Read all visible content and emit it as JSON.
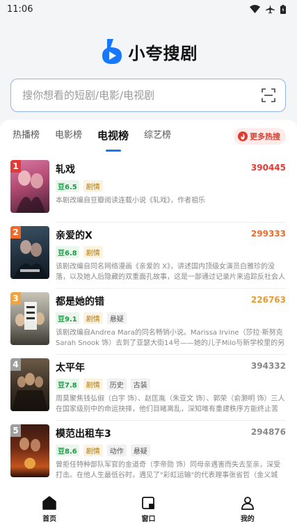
{
  "status_bar": {
    "time": "11:06"
  },
  "app": {
    "name": "小夸搜剧"
  },
  "search": {
    "placeholder": "搜你想看的短剧/电影/电视剧"
  },
  "tabs": [
    {
      "label": "热播榜"
    },
    {
      "label": "电影榜"
    },
    {
      "label": "电视榜"
    },
    {
      "label": "综艺榜"
    }
  ],
  "more_hot": {
    "label": "更多热搜"
  },
  "items": [
    {
      "rank": "1",
      "rank_color": "#e53935",
      "title": "轧戏",
      "heat": "390445",
      "heat_color": "#e53935",
      "score": "豆6.5",
      "genres": [
        "剧情"
      ],
      "desc": "本剧改编自豆瓣阅读连载小说《轧戏》，作者祖乐"
    },
    {
      "rank": "2",
      "rank_color": "#f06a28",
      "title": "亲爱的X",
      "heat": "299333",
      "heat_color": "#f06a28",
      "score": "豆6.8",
      "genres": [
        "剧情"
      ],
      "desc": "该剧改编自同名网络漫画《亲爱的 X》，讲述国内顶级女演员白雅珍的没落，以及她人后隐藏的双重面孔故事，这是一部通过记录片来追踪反社会人格女演员…"
    },
    {
      "rank": "3",
      "rank_color": "#f2a33a",
      "title": "都是她的错",
      "heat": "226763",
      "heat_color": "#e89a2c",
      "score": "豆9.1",
      "genres": [
        "剧情",
        "悬疑"
      ],
      "desc": "该剧改编自Andrea Mara的同名畅销小说。Marissa Irvine（莎拉·斯努克 Sarah Snook 饰）去到了亚瑟大街14号——她的儿子Milo与新学校里的另一个男孩在…"
    },
    {
      "rank": "4",
      "rank_color": "#9e9e9e",
      "title": "太平年",
      "heat": "394332",
      "heat_color": "#888888",
      "score": "豆7.8",
      "genres": [
        "剧情",
        "历史",
        "古装"
      ],
      "desc": "周莫聚焦钱弘俶（白宇 饰）、赵匡胤（朱亚文 饰）、郭荣（俞灏明 饰）三人在国家级别中的命运抉择，他们目睹离乱，深知唯有重建秩序方能终止苦难。钱…"
    },
    {
      "rank": "5",
      "rank_color": "#9e9e9e",
      "title": "模范出租车3",
      "heat": "294876",
      "heat_color": "#888888",
      "score": "豆8.6",
      "genres": [
        "剧情",
        "动作",
        "悬疑"
      ],
      "desc": "曾拒任特种部队军官的金道奇（李帝勋 饰）同母亲遇害而失去至亲，深受打击。在他人生最低谷时，遇见了\"彩虹运输\"的代表理事张省哲（金义城 饰）。"
    }
  ],
  "bottom_nav": [
    {
      "label": "首页"
    },
    {
      "label": "窗口"
    },
    {
      "label": "我的"
    }
  ],
  "colors": {
    "accent": "#1677ff",
    "search_border": "#8fb4ee",
    "more_hot": "#e03a2e"
  }
}
